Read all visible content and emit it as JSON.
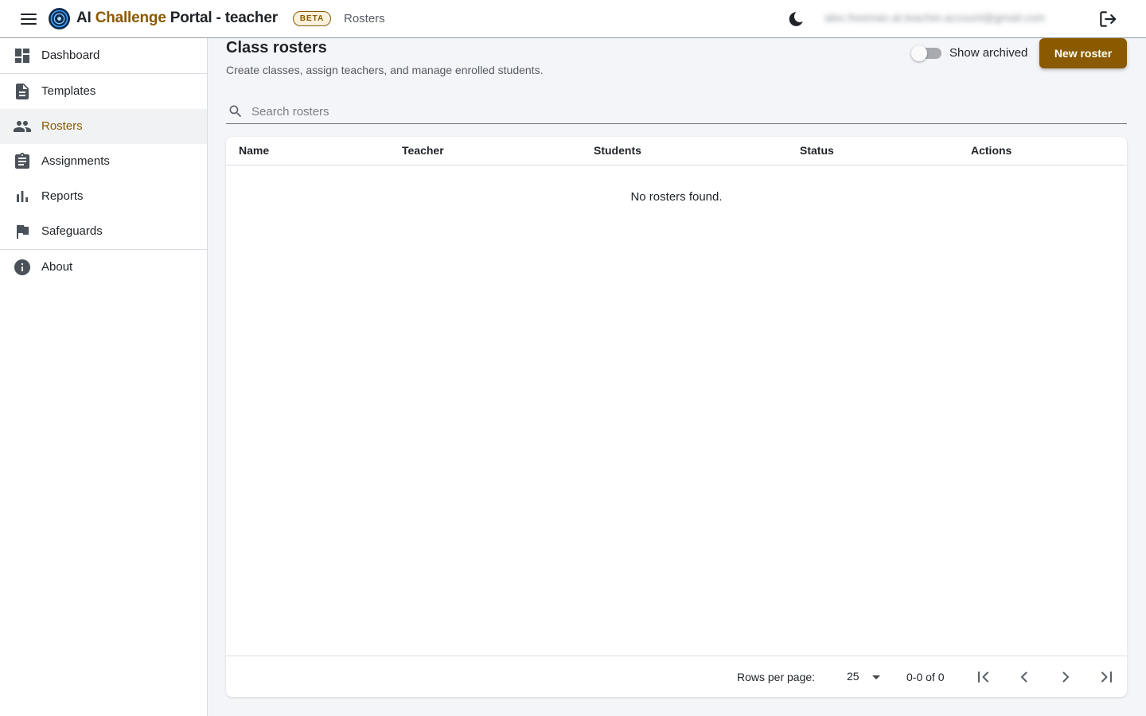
{
  "header": {
    "brand_part1": "AI ",
    "brand_part2": "Challenge",
    "brand_part3": " Portal - teacher",
    "beta_badge": "BETA",
    "breadcrumb": "Rosters",
    "user_email": "alex.freeman.at.teacher.account@gmail.com",
    "icons": [
      "menu-icon",
      "app-logo",
      "dark-mode-moon-icon",
      "logout-icon"
    ]
  },
  "sidebar": {
    "items": [
      {
        "label": "Dashboard",
        "icon": "dashboard-icon",
        "active": false
      },
      {
        "label": "Templates",
        "icon": "document-icon",
        "active": false
      },
      {
        "label": "Rosters",
        "icon": "people-icon",
        "active": true
      },
      {
        "label": "Assignments",
        "icon": "clipboard-icon",
        "active": false
      },
      {
        "label": "Reports",
        "icon": "bar-chart-icon",
        "active": false
      },
      {
        "label": "Safeguards",
        "icon": "flag-icon",
        "active": false
      },
      {
        "label": "About",
        "icon": "info-icon",
        "active": false
      }
    ]
  },
  "main": {
    "title": "Class rosters",
    "subtitle": "Create classes, assign teachers, and manage enrolled students.",
    "show_archived_label": "Show archived",
    "show_archived_on": false,
    "new_button": "New roster",
    "search_placeholder": "Search rosters",
    "search_value": "",
    "table": {
      "columns": [
        "Name",
        "Teacher",
        "Students",
        "Status",
        "Actions"
      ],
      "rows": [],
      "empty_message": "No rosters found."
    },
    "pagination": {
      "rows_per_page_label": "Rows per page:",
      "rows_per_page": "25",
      "range": "0-0 of 0"
    }
  },
  "colors": {
    "accent": "#8a5a00",
    "accent_light": "#fbf1dc",
    "text": "#1f2328",
    "muted": "#555b63",
    "page_bg": "#f3f5f8"
  }
}
